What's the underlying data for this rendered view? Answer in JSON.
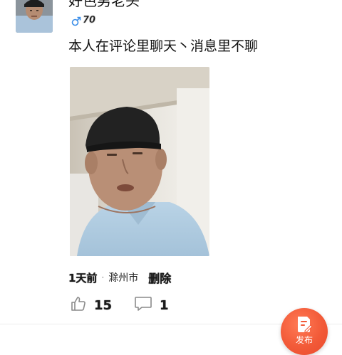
{
  "post": {
    "username": "好色男老头",
    "gender_icon": "male-icon",
    "gender_color": "#3b8ee8",
    "level": "70",
    "content": "本人在评论里聊天丶消息里不聊",
    "time": "1天前",
    "separator": "·",
    "location": "滁州市",
    "delete_label": "删除",
    "like_icon": "thumbs-up-icon",
    "likes": "15",
    "comment_icon": "comment-bubble-icon",
    "comments": "1"
  },
  "fab": {
    "icon": "edit-document-icon",
    "label": "发布",
    "color": "#f25a38"
  }
}
